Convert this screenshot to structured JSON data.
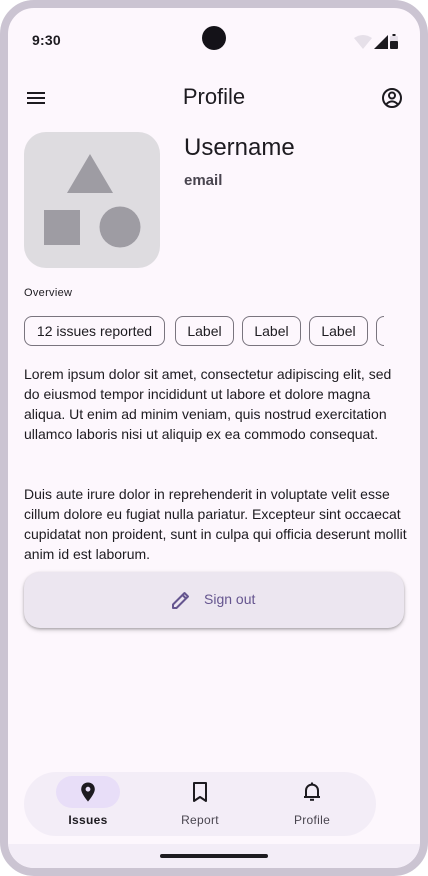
{
  "status_bar": {
    "time": "9:30",
    "icons": [
      "wifi-icon",
      "cellular-signal-icon",
      "battery-icon"
    ]
  },
  "top_bar": {
    "title": "Profile",
    "menu_icon": "menu-icon",
    "account_icon": "account-circle-icon"
  },
  "profile": {
    "avatar_icon": "shapes-placeholder-icon",
    "username": "Username",
    "email": "email"
  },
  "overview": {
    "label": "Overview",
    "chips": [
      "12 issues reported",
      "Label",
      "Label",
      "Label",
      ""
    ]
  },
  "body": {
    "paragraph_1": "Lorem ipsum dolor sit amet, consectetur adipiscing elit, sed do eiusmod tempor incididunt ut labore et dolore magna aliqua. Ut enim ad minim veniam, quis nostrud exercitation ullamco laboris nisi ut aliquip ex ea commodo consequat.",
    "paragraph_2": "Duis aute irure dolor in reprehenderit in voluptate velit esse cillum dolore eu fugiat nulla pariatur. Excepteur sint occaecat cupidatat non proident, sunt in culpa qui officia deserunt mollit anim id est laborum."
  },
  "sign_out": {
    "label": "Sign out",
    "icon": "pencil-icon"
  },
  "bottom_nav": {
    "items": [
      {
        "label": "Issues",
        "icon": "location-pin-icon",
        "active": true
      },
      {
        "label": "Report",
        "icon": "bookmark-icon",
        "active": false
      },
      {
        "label": "Profile",
        "icon": "bell-icon",
        "active": false
      }
    ]
  },
  "colors": {
    "background": "#fdf7fd",
    "device_frame": "#cbc4d2",
    "accent": "#65558f",
    "active_indicator": "#e8def8",
    "surface_container": "#f3edf7"
  }
}
